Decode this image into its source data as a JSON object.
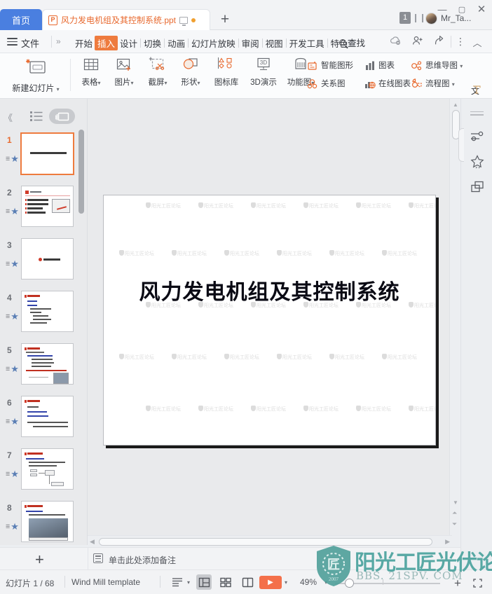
{
  "window": {
    "home_tab": "首页",
    "doc_tab_title": "风力发电机组及其控制系统.ppt",
    "new_tab": "+",
    "minimize": "—",
    "maximize": "▢",
    "close": "✕",
    "tab_count": "1",
    "user_name": "Mr_Ta..."
  },
  "menubar": {
    "file": "文件",
    "overflow_prev": "»",
    "tabs": [
      {
        "label": "开始",
        "active": false
      },
      {
        "label": "插入",
        "active": true
      },
      {
        "label": "设计",
        "active": false
      },
      {
        "label": "切换",
        "active": false
      },
      {
        "label": "动画",
        "active": false
      },
      {
        "label": "幻灯片放映",
        "active": false
      },
      {
        "label": "审阅",
        "active": false
      },
      {
        "label": "视图",
        "active": false
      },
      {
        "label": "开发工具",
        "active": false
      },
      {
        "label": "特色功能",
        "active": false
      }
    ],
    "overflow_next": "›",
    "find": "查找",
    "cloud_icon": "cloud-icon",
    "share_user_icon": "add-user-icon",
    "export_icon": "share-icon",
    "more_icon": "⋮",
    "collapse_icon": "︿"
  },
  "ribbon": {
    "new_slide": "新建幻灯片",
    "groups": [
      {
        "label": "表格",
        "has_caret": true
      },
      {
        "label": "图片",
        "has_caret": true
      },
      {
        "label": "截屏",
        "has_caret": true
      },
      {
        "label": "形状",
        "has_caret": true
      },
      {
        "label": "图标库",
        "has_caret": false
      },
      {
        "label": "3D演示",
        "has_caret": false
      },
      {
        "label": "功能图",
        "has_caret": true
      }
    ],
    "list_col1": [
      {
        "label": "智能图形",
        "has_caret": false
      },
      {
        "label": "关系图",
        "has_caret": false
      }
    ],
    "list_col2": [
      {
        "label": "图表",
        "has_caret": false
      },
      {
        "label": "在线图表",
        "has_caret": false
      }
    ],
    "list_col3": [
      {
        "label": "思维导图",
        "has_caret": true
      },
      {
        "label": "流程图",
        "has_caret": true
      }
    ],
    "text_tool": "文",
    "scroll_right": "›"
  },
  "left_panel": {
    "collapse": "《",
    "outline_view": "outline-view-icon",
    "thumbnail_view": "thumbnail-view-icon",
    "slides": [
      {
        "num": "1",
        "selected": true
      },
      {
        "num": "2",
        "selected": false
      },
      {
        "num": "3",
        "selected": false
      },
      {
        "num": "4",
        "selected": false
      },
      {
        "num": "5",
        "selected": false
      },
      {
        "num": "6",
        "selected": false
      },
      {
        "num": "7",
        "selected": false
      },
      {
        "num": "8",
        "selected": false
      }
    ]
  },
  "slide": {
    "title": "风力发电机组及其控制系统",
    "watermark_text": "阳光工匠论坛"
  },
  "notes": {
    "add_slide": "+",
    "placeholder": "单击此处添加备注"
  },
  "status": {
    "slide_counter": "幻灯片 1 / 68",
    "template_name": "Wind Mill template",
    "view_normal": "normal-view-icon",
    "view_sorter": "slide-sorter-icon",
    "view_reading": "reading-view-icon",
    "play": "▶",
    "zoom": "49%",
    "zoom_caret": "▾",
    "plus": "+",
    "fit": "fit-to-window-icon"
  },
  "right_rail": {
    "items": [
      "settings-sliders-icon",
      "star-effects-icon",
      "layers-icon"
    ]
  },
  "forum_watermark": {
    "title": "阳光工匠光伏论坛",
    "url": "BBS. 21SPV. COM",
    "year": "2007"
  },
  "colors": {
    "accent_orange": "#ee7b3e",
    "home_blue": "#4a7fe0",
    "play_red": "#f4704a",
    "watermark_teal": "#57a8a4"
  }
}
